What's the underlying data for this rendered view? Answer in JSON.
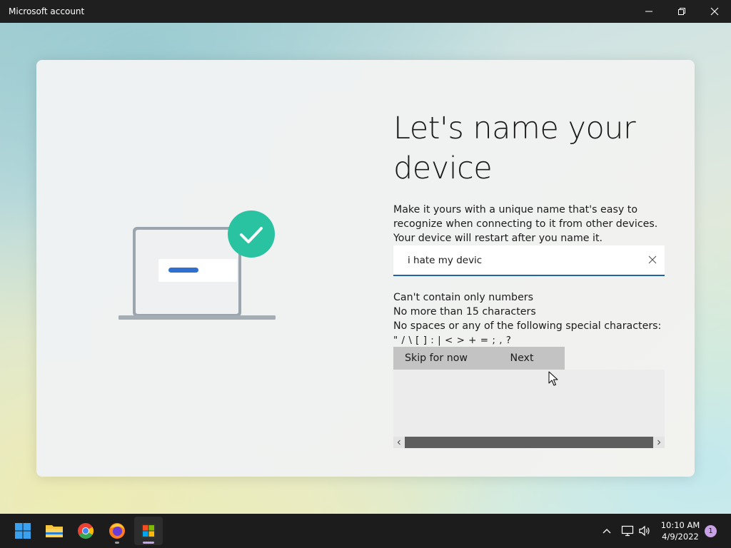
{
  "window": {
    "title": "Microsoft account"
  },
  "main": {
    "heading": "Let's name your device",
    "description": "Make it yours with a unique name that's easy to recognize when connecting to it from other devices. Your device will restart after you name it.",
    "input_value": "i hate my devic",
    "rules": [
      "Can't contain only numbers",
      "No more than 15 characters",
      "No spaces or any of the following special characters:",
      "\" / \\ [ ] : | < > + = ; , ?"
    ],
    "skip_label": "Skip for now",
    "next_label": "Next"
  },
  "taskbar": {
    "apps": [
      "start-icon",
      "file-explorer-icon",
      "chrome-icon",
      "firefox-icon",
      "microsoft-store-icon"
    ],
    "time": "10:10 AM",
    "date": "4/9/2022",
    "notification_count": "1"
  },
  "colors": {
    "accent": "#2363a3",
    "check_badge": "#2ac3a2",
    "titlebar": "#1f1f1f",
    "taskbar": "#1c1c1c"
  }
}
